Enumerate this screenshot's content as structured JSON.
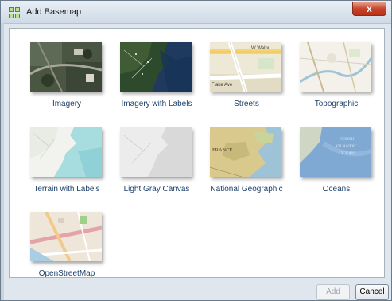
{
  "window": {
    "title": "Add Basemap",
    "close_label": "x"
  },
  "basemaps": [
    {
      "label": "Imagery"
    },
    {
      "label": "Imagery with Labels"
    },
    {
      "label": "Streets"
    },
    {
      "label": "Topographic"
    },
    {
      "label": "Terrain with Labels"
    },
    {
      "label": "Light Gray Canvas"
    },
    {
      "label": "National Geographic"
    },
    {
      "label": "Oceans"
    },
    {
      "label": "OpenStreetMap"
    }
  ],
  "thumb_text": {
    "streets_road": "W Walnu",
    "streets_ave": "Flake Ave",
    "natgeo_country": "FRANCE",
    "oceans_1": "NORTH",
    "oceans_2": "ATLANTIC",
    "oceans_3": "OCEAN"
  },
  "buttons": {
    "add": "Add",
    "cancel": "Cancel"
  },
  "colors": {
    "label_text": "#1d3f6a",
    "close_button": "#c7442c"
  }
}
